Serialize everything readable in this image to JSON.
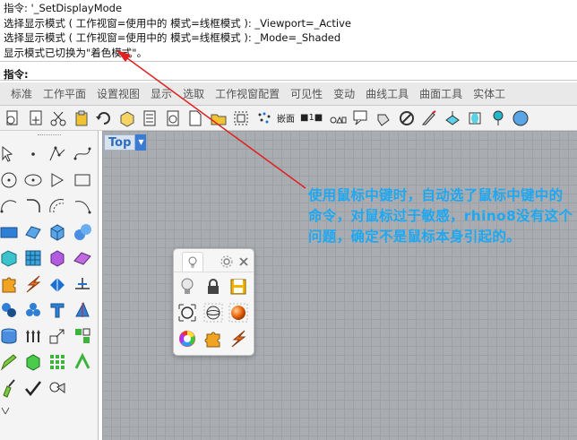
{
  "command_history": {
    "lines": [
      "指令: '_SetDisplayMode",
      "选择显示模式 ( 工作视窗=使用中的  模式=线框模式 ): _Viewport=_Active",
      "选择显示模式 ( 工作视窗=使用中的  模式=线框模式 ): _Mode=_Shaded",
      "显示模式已切换为\"着色模式\"。"
    ]
  },
  "command_prompt": {
    "label": "指令:",
    "value": ""
  },
  "tabs": [
    "标准",
    "工作平面",
    "设置视图",
    "显示",
    "选取",
    "工作视窗配置",
    "可见性",
    "变动",
    "曲线工具",
    "曲面工具",
    "实体工"
  ],
  "toolbar": {
    "text_items": [
      "嵌面",
      "■1■"
    ]
  },
  "viewport": {
    "name": "Top",
    "menu_arrow": "▼"
  },
  "annotation": {
    "text": "使用鼠标中键时，自动选了鼠标中键中的命令，对鼠标过于敏感，rhino8没有这个问题，确定不是鼠标本身引起的。",
    "color": "#1ea8f2"
  },
  "colors": {
    "arrow": "#e02020",
    "viewport_bg": "#a9adb1",
    "accent": "#3a7bd5"
  }
}
